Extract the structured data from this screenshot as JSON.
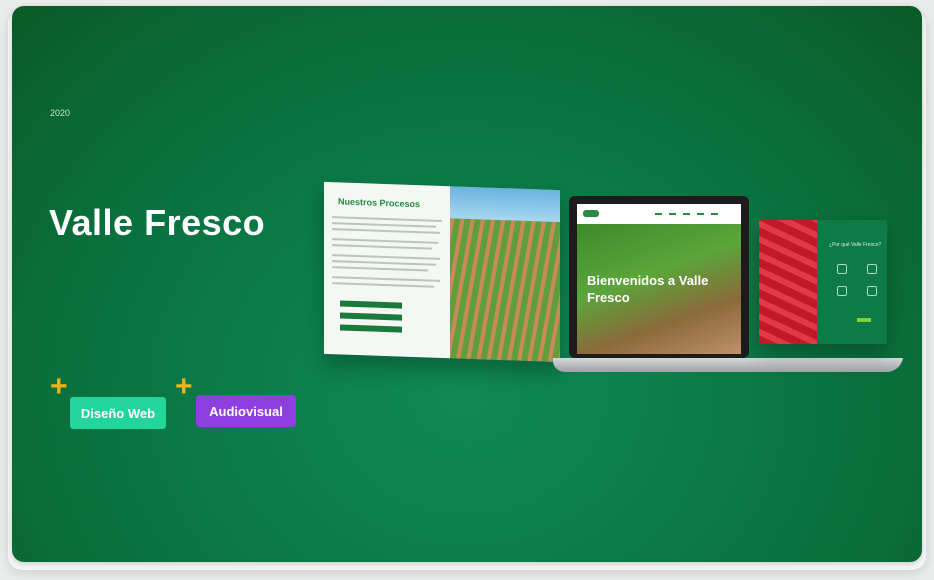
{
  "project": {
    "year": "2020",
    "title": "Valle Fresco"
  },
  "tags": [
    {
      "label": "Diseño Web",
      "color": "#22d59a"
    },
    {
      "label": "Audiovisual",
      "color": "#8f3ee0"
    }
  ],
  "mockups": {
    "screen1_heading": "Nuestros Procesos",
    "laptop_hero": "Bienvenidos a Valle Fresco",
    "screen3_heading": "¿Por qué Valle Fresco?"
  },
  "icons": {
    "plus": "plus-icon"
  },
  "colors": {
    "background": "#0b7a47",
    "accent": "#f2b31a"
  }
}
